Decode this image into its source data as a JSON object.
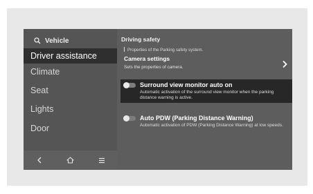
{
  "sidebar": {
    "search_label": "Vehicle",
    "items": [
      {
        "label": "Driver assistance",
        "active": true
      },
      {
        "label": "Climate",
        "active": false
      },
      {
        "label": "Seat",
        "active": false
      },
      {
        "label": "Lights",
        "active": false
      },
      {
        "label": "Door",
        "active": false
      }
    ],
    "bottom_icons": [
      "back-icon",
      "home-icon",
      "menu-icon"
    ]
  },
  "main": {
    "section_title": "Driving safety",
    "properties_text": "Properties of the Parking safety system.",
    "camera": {
      "title": "Camera settings",
      "subtitle": "Sets the properties of camera."
    },
    "settings": [
      {
        "title": "Surround view monitor auto on",
        "description": "Automatic activation of the surround view monitor when the parking distance warning is active.",
        "enabled": false,
        "highlighted": true
      },
      {
        "title": "Auto PDW (Parking Distance Warning)",
        "description": "Automatic activation of PDW (Parking Distance Warning) at low speeds.",
        "enabled": false,
        "highlighted": false
      }
    ]
  }
}
